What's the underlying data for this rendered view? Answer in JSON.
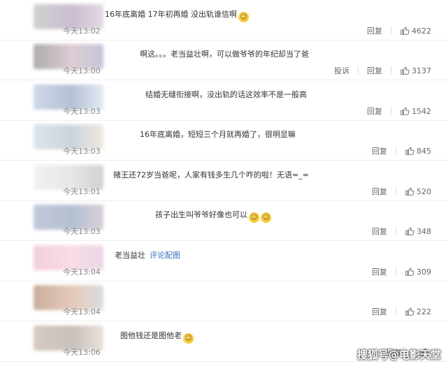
{
  "comments": [
    {
      "text": "16年底离婚 17年初再婚 没出轨谁信啊",
      "emoji": "shush-emoji",
      "time": "今天13:02",
      "reply": "回复",
      "likes": "4622",
      "avatar_colors": [
        "#c9c9c9",
        "#c2b2c8",
        "#dcd3de"
      ]
    },
    {
      "text": "啊这。。。老当益壮啊，可以做爷爷的年纪却当了爸",
      "time": "今天13:00",
      "report": "投诉",
      "reply": "回复",
      "likes": "3137",
      "avatar_colors": [
        "#9f9f9f",
        "#d8c3cc",
        "#bcbcd4"
      ]
    },
    {
      "text": "结婚无缝衔接啊，没出轨的话这效率不是一般高",
      "time": "今天13:03",
      "reply": "回复",
      "likes": "1542",
      "avatar_colors": [
        "#c7d1e5",
        "#aab6cd",
        "#dde6f0"
      ]
    },
    {
      "text": "16年底离婚，短短三个月就再婚了，很明显嘛",
      "time": "今天13:03",
      "reply": "回复",
      "likes": "845",
      "avatar_colors": [
        "#d6e0e8",
        "#c4cdd6",
        "#ece4da"
      ]
    },
    {
      "text": "赌王还72岁当爸呢，人家有钱多生几个咋的啦！无语=_=",
      "time": "今天13:01",
      "reply": "回复",
      "likes": "520",
      "avatar_colors": [
        "#f0f0f0",
        "#e3e3e3",
        "#c9c9c9"
      ]
    },
    {
      "text": "孩子出生叫爷爷好像也可以",
      "emoji": "laugh-cry-emoji",
      "time": "今天13:03",
      "reply": "回复",
      "likes": "348",
      "avatar_colors": [
        "#b9c0d6",
        "#a7b5c9",
        "#d3c7d0"
      ]
    },
    {
      "text": "老当益壮",
      "link": "评论配图",
      "time": "今天13:04",
      "reply": "回复",
      "likes": "309",
      "avatar_colors": [
        "#f2c7d8",
        "#f7d6e2",
        "#e6d0e0"
      ]
    },
    {
      "text": "",
      "time": "今天13:04",
      "reply": "回复",
      "likes": "222",
      "avatar_colors": [
        "#c2a08c",
        "#e0c2b0",
        "#d7d7d7"
      ]
    },
    {
      "text": "图他钱还是图他老",
      "emoji": "laugh-cry-emoji",
      "time": "今天13:06",
      "reply": "回复",
      "likes": "",
      "avatar_colors": [
        "#d0c1b8",
        "#bfb6b0",
        "#e4dcd6"
      ]
    }
  ],
  "watermark": "搜狐号@电影天堂"
}
